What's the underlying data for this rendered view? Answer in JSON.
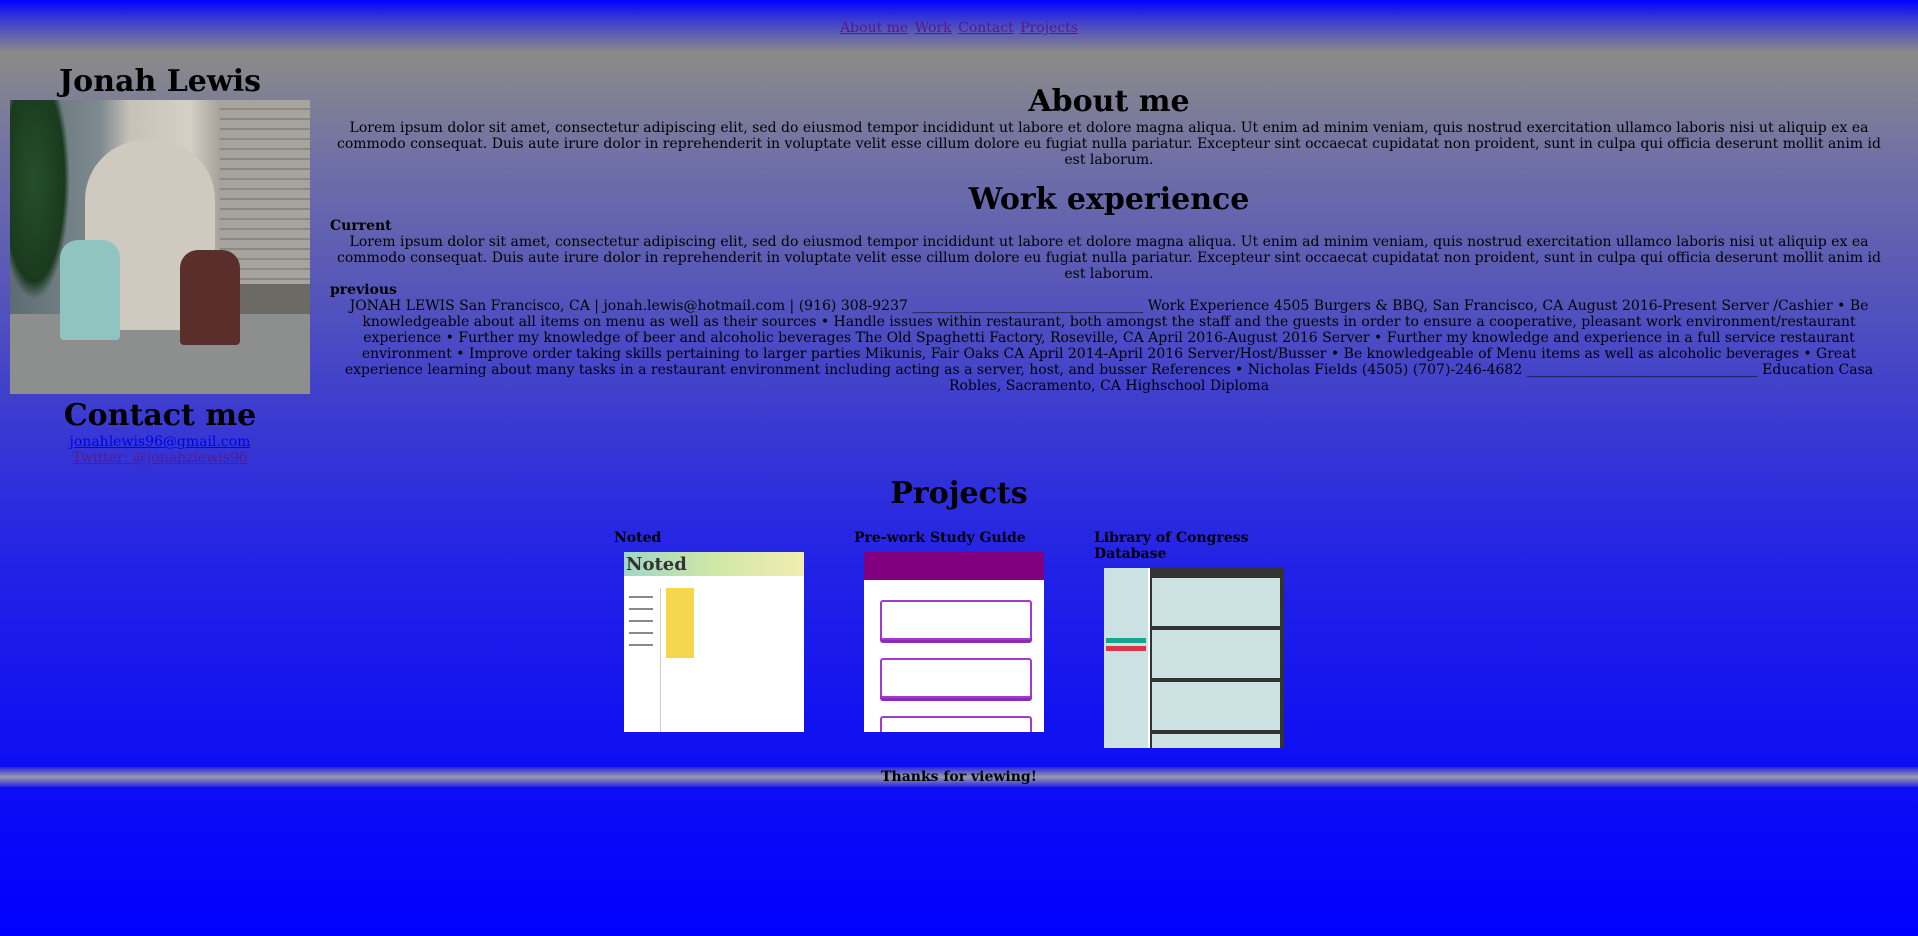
{
  "nav": {
    "items": [
      "About me",
      "Work",
      "Contact",
      "Projects"
    ]
  },
  "sidebar": {
    "name": "Jonah Lewis",
    "contact_heading": "Contact me",
    "email": "jonahlewis96@gmail.com",
    "twitter": "Twitter: @jonahzlewis96"
  },
  "about": {
    "heading": "About me",
    "text": "Lorem ipsum dolor sit amet, consectetur adipiscing elit, sed do eiusmod tempor incididunt ut labore et dolore magna aliqua. Ut enim ad minim veniam, quis nostrud exercitation ullamco laboris nisi ut aliquip ex ea commodo consequat. Duis aute irure dolor in reprehenderit in voluptate velit esse cillum dolore eu fugiat nulla pariatur. Excepteur sint occaecat cupidatat non proident, sunt in culpa qui officia deserunt mollit anim id est laborum."
  },
  "work": {
    "heading": "Work experience",
    "current_label": "Current",
    "current_text": "Lorem ipsum dolor sit amet, consectetur adipiscing elit, sed do eiusmod tempor incididunt ut labore et dolore magna aliqua. Ut enim ad minim veniam, quis nostrud exercitation ullamco laboris nisi ut aliquip ex ea commodo consequat. Duis aute irure dolor in reprehenderit in voluptate velit esse cillum dolore eu fugiat nulla pariatur. Excepteur sint occaecat cupidatat non proident, sunt in culpa qui officia deserunt mollit anim id est laborum.",
    "previous_label": "previous",
    "previous_text": "JONAH LEWIS San Francisco, CA | jonah.lewis@hotmail.com | (916) 308-9237 _________________________________ Work Experience 4505 Burgers & BBQ, San Francisco, CA August 2016-Present Server /Cashier • Be knowledgeable about all items on menu as well as their sources • Handle issues within restaurant, both amongst the staff and the guests in order to ensure a cooperative, pleasant work environment/restaurant experience • Further my knowledge of beer and alcoholic beverages The Old Spaghetti Factory, Roseville, CA April 2016-August 2016 Server • Further my knowledge and experience in a full service restaurant environment • Improve order taking skills pertaining to larger parties Mikunis, Fair Oaks CA April 2014-April 2016 Server/Host/Busser • Be knowledgeable of Menu items as well as alcoholic beverages • Great experience learning about many tasks in a restaurant environment including acting as a server, host, and busser References • Nicholas Fields (4505) (707)-246-4682 _________________________________ Education Casa Robles, Sacramento, CA Highschool Diploma"
  },
  "projects": {
    "heading": "Projects",
    "items": [
      {
        "title": "Noted",
        "thumb_logo": "Noted"
      },
      {
        "title": "Pre-work Study Guide"
      },
      {
        "title": "Library of Congress Database"
      }
    ]
  },
  "footer": {
    "text": "Thanks for viewing!"
  }
}
